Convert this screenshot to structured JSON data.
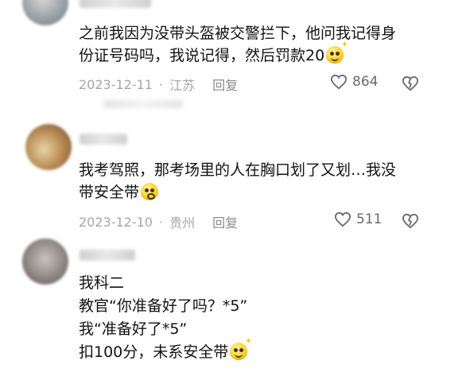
{
  "comments": [
    {
      "text": "之前我因为没带头盔被交警拦下，他问我记得身\n份证号码吗，我说记得，然后罚款20",
      "emoji": "smile-sparkle-emoji",
      "date": "2023-12-11",
      "separator": "·",
      "location": "江苏",
      "reply_label": "回复",
      "likes": "864"
    },
    {
      "text": "我考驾照，那考场里的人在胸口划了又划…我没\n带安全带",
      "emoji": "flushed-emoji",
      "date": "2023-12-10",
      "separator": "·",
      "location": "贵州",
      "reply_label": "回复",
      "likes": "511"
    },
    {
      "text": "我科二\n教官“你准备好了吗？*5”\n我“准备好了*5”\n扣100分，未系安全带",
      "emoji": "smile-sparkle-emoji"
    }
  ],
  "icons": {
    "like": "heart-outline-icon",
    "dislike": "broken-heart-icon"
  },
  "colors": {
    "text": "#121212",
    "meta": "#a6a6a6",
    "icon": "#6a6a6a"
  }
}
